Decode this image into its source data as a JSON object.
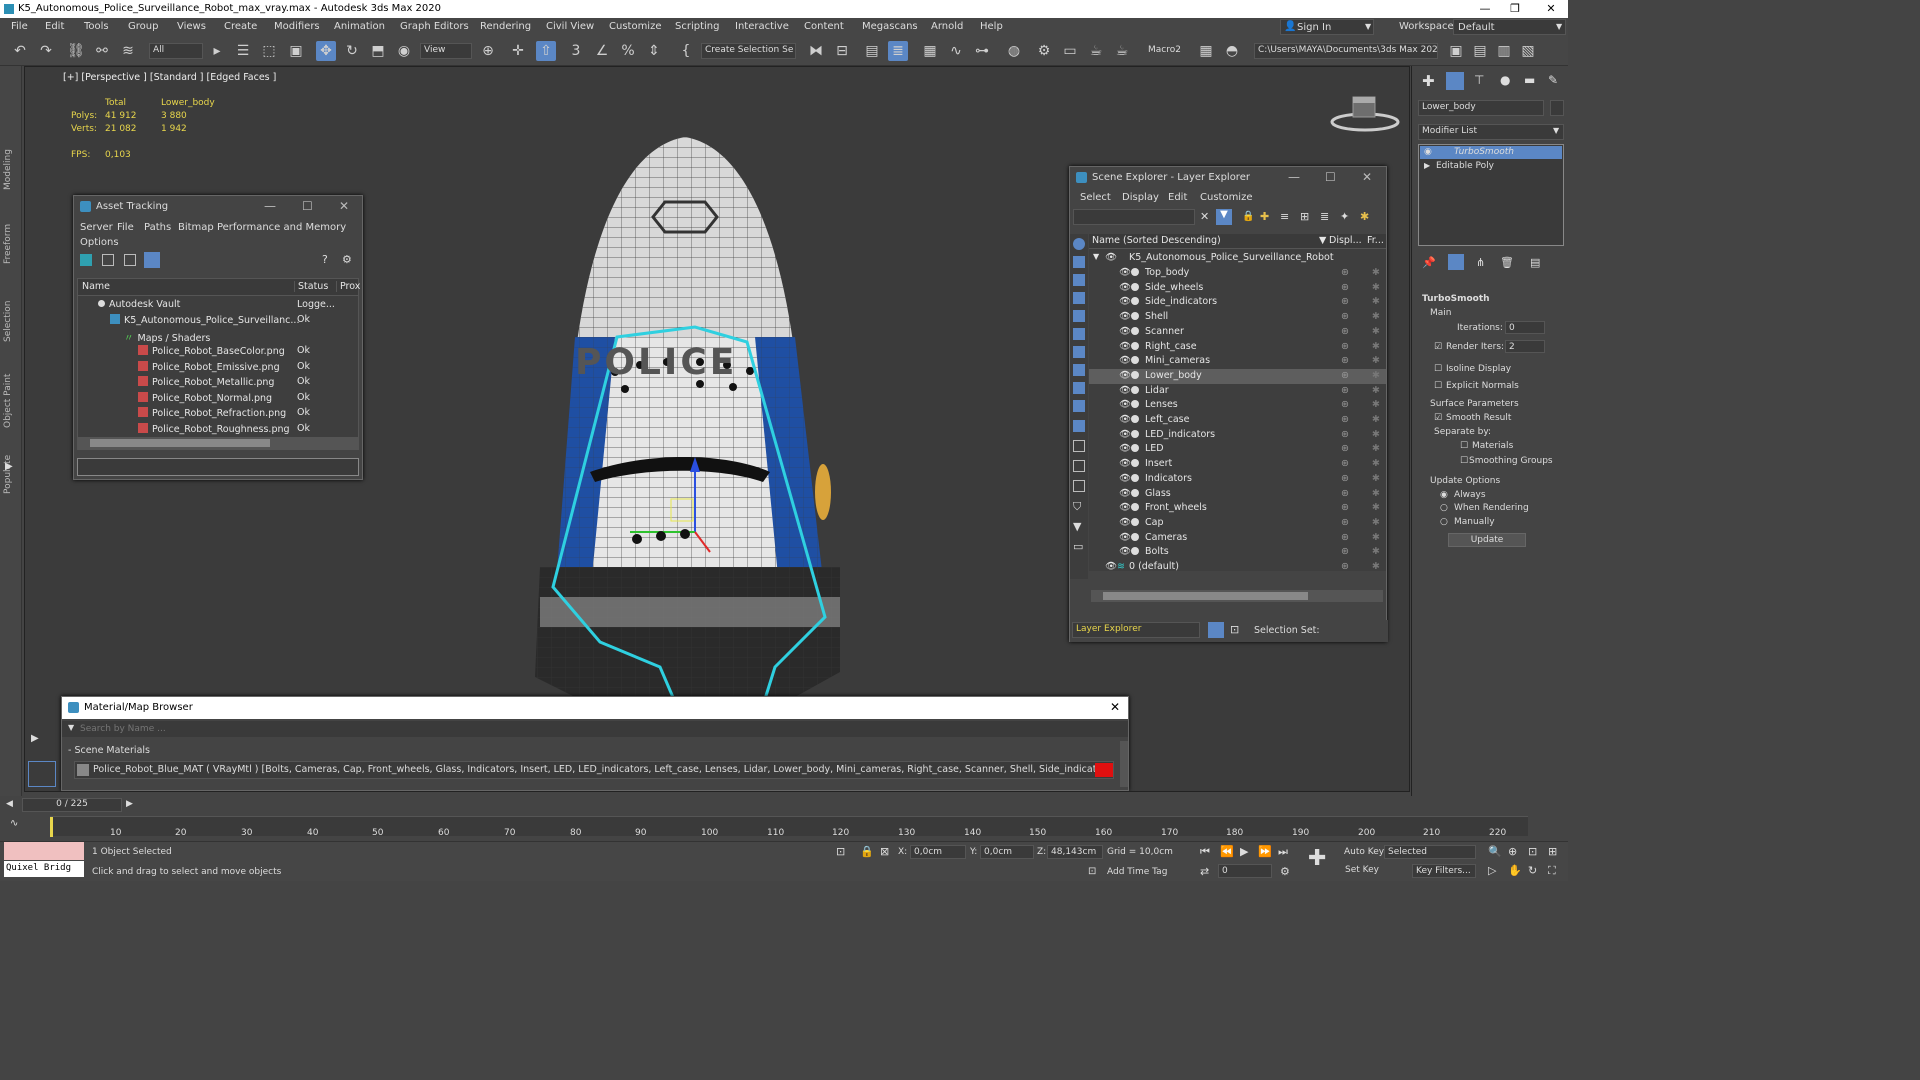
{
  "title": "K5_Autonomous_Police_Surveillance_Robot_max_vray.max - Autodesk 3ds Max 2020",
  "menu": [
    "File",
    "Edit",
    "Tools",
    "Group",
    "Views",
    "Create",
    "Modifiers",
    "Animation",
    "Graph Editors",
    "Rendering",
    "Civil View",
    "Customize",
    "Scripting",
    "Interactive",
    "Content",
    "Megascans",
    "Arnold",
    "Help"
  ],
  "account": {
    "sign_in": "Sign In",
    "workspaces_label": "Workspaces:",
    "workspace": "Default"
  },
  "toolbar": {
    "filter": "All",
    "view": "View",
    "selection_set": "Create Selection Se",
    "macro": "Macro2",
    "path": "C:\\Users\\MAYA\\Documents\\3ds Max 2020"
  },
  "side_tabs": [
    "Modeling",
    "Freeform",
    "Selection",
    "Object Paint",
    "Populate"
  ],
  "viewport": {
    "label": "[+] [Perspective ] [Standard ] [Edged Faces ]",
    "stats": {
      "total": "Total",
      "selected": "Lower_body",
      "polys_label": "Polys:",
      "polys_total": "41 912",
      "polys_sel": "3 880",
      "verts_label": "Verts:",
      "verts_total": "21 082",
      "verts_sel": "1 942",
      "fps_label": "FPS:",
      "fps": "0,103"
    },
    "police_text": "POLICE"
  },
  "asset_tracking": {
    "title": "Asset Tracking",
    "menu": [
      "Server",
      "File",
      "Paths",
      "Bitmap Performance and Memory"
    ],
    "menu2": "Options",
    "columns": [
      "Name",
      "Status",
      "Prox"
    ],
    "rows": [
      {
        "name": "Autodesk Vault",
        "status": "Logge..."
      },
      {
        "name": "K5_Autonomous_Police_Surveillanc...",
        "status": "Ok"
      },
      {
        "name": "Maps / Shaders",
        "status": ""
      },
      {
        "name": "Police_Robot_BaseColor.png",
        "status": "Ok"
      },
      {
        "name": "Police_Robot_Emissive.png",
        "status": "Ok"
      },
      {
        "name": "Police_Robot_Metallic.png",
        "status": "Ok"
      },
      {
        "name": "Police_Robot_Normal.png",
        "status": "Ok"
      },
      {
        "name": "Police_Robot_Refraction.png",
        "status": "Ok"
      },
      {
        "name": "Police_Robot_Roughness.png",
        "status": "Ok"
      }
    ]
  },
  "scene_explorer": {
    "title": "Scene Explorer - Layer Explorer",
    "menu": [
      "Select",
      "Display",
      "Edit",
      "Customize"
    ],
    "col_name": "Name (Sorted Descending)",
    "col_disp": "Displ...",
    "col_fr": "Fr...",
    "root": "K5_Autonomous_Police_Surveillance_Robot",
    "items": [
      "Top_body",
      "Side_wheels",
      "Side_indicators",
      "Shell",
      "Scanner",
      "Right_case",
      "Mini_cameras",
      "Lower_body",
      "Lidar",
      "Lenses",
      "Left_case",
      "LED_indicators",
      "LED",
      "Insert",
      "Indicators",
      "Glass",
      "Front_wheels",
      "Cap",
      "Cameras",
      "Bolts"
    ],
    "default_layer": "0 (default)",
    "footer_label": "Layer Explorer",
    "selection_set": "Selection Set:"
  },
  "material_browser": {
    "title": "Material/Map Browser",
    "search_placeholder": "Search by Name ...",
    "section": "- Scene Materials",
    "material": "Police_Robot_Blue_MAT ( VRayMtl ) [Bolts, Cameras, Cap, Front_wheels, Glass, Indicators, Insert, LED, LED_indicators, Left_case, Lenses, Lidar, Lower_body, Mini_cameras, Right_case, Scanner, Shell, Side_indicators, Side_wheels, Top_body]"
  },
  "command_panel": {
    "object_name": "Lower_body",
    "modifier_list": "Modifier List",
    "stack": [
      "TurboSmooth",
      "Editable Poly"
    ],
    "rollout": "TurboSmooth",
    "main": "Main",
    "iterations_label": "Iterations:",
    "iterations": "0",
    "render_iters_label": "Render Iters:",
    "render_iters": "2",
    "isoline": "Isoline Display",
    "explicit_normals": "Explicit Normals",
    "surface_params": "Surface Parameters",
    "smooth_result": "Smooth Result",
    "separate_by": "Separate by:",
    "materials": "Materials",
    "smoothing_groups": "Smoothing Groups",
    "update_options": "Update Options",
    "always": "Always",
    "when_rendering": "When Rendering",
    "manually": "Manually",
    "update_btn": "Update"
  },
  "timeline": {
    "frame": "0 / 225",
    "ticks": [
      "10",
      "20",
      "30",
      "40",
      "50",
      "60",
      "70",
      "80",
      "90",
      "100",
      "110",
      "120",
      "130",
      "140",
      "150",
      "160",
      "170",
      "180",
      "190",
      "200",
      "210",
      "220"
    ]
  },
  "status": {
    "quixel": "Quixel Bridg",
    "selected": "1 Object Selected",
    "hint": "Click and drag to select and move objects",
    "x_label": "X:",
    "x": "0,0cm",
    "y_label": "Y:",
    "y": "0,0cm",
    "z_label": "Z:",
    "z": "48,143cm",
    "grid": "Grid = 10,0cm",
    "add_time_tag": "Add Time Tag",
    "auto_key": "Auto Key",
    "set_key": "Set Key",
    "key_mode": "Selected",
    "key_filters": "Key Filters...",
    "frame_field": "0"
  },
  "colors": {
    "accent": "#5b87c5",
    "selection": "#2fd0e0",
    "stat_text": "#e8d64c",
    "robot_blue": "#1f4fa3"
  }
}
